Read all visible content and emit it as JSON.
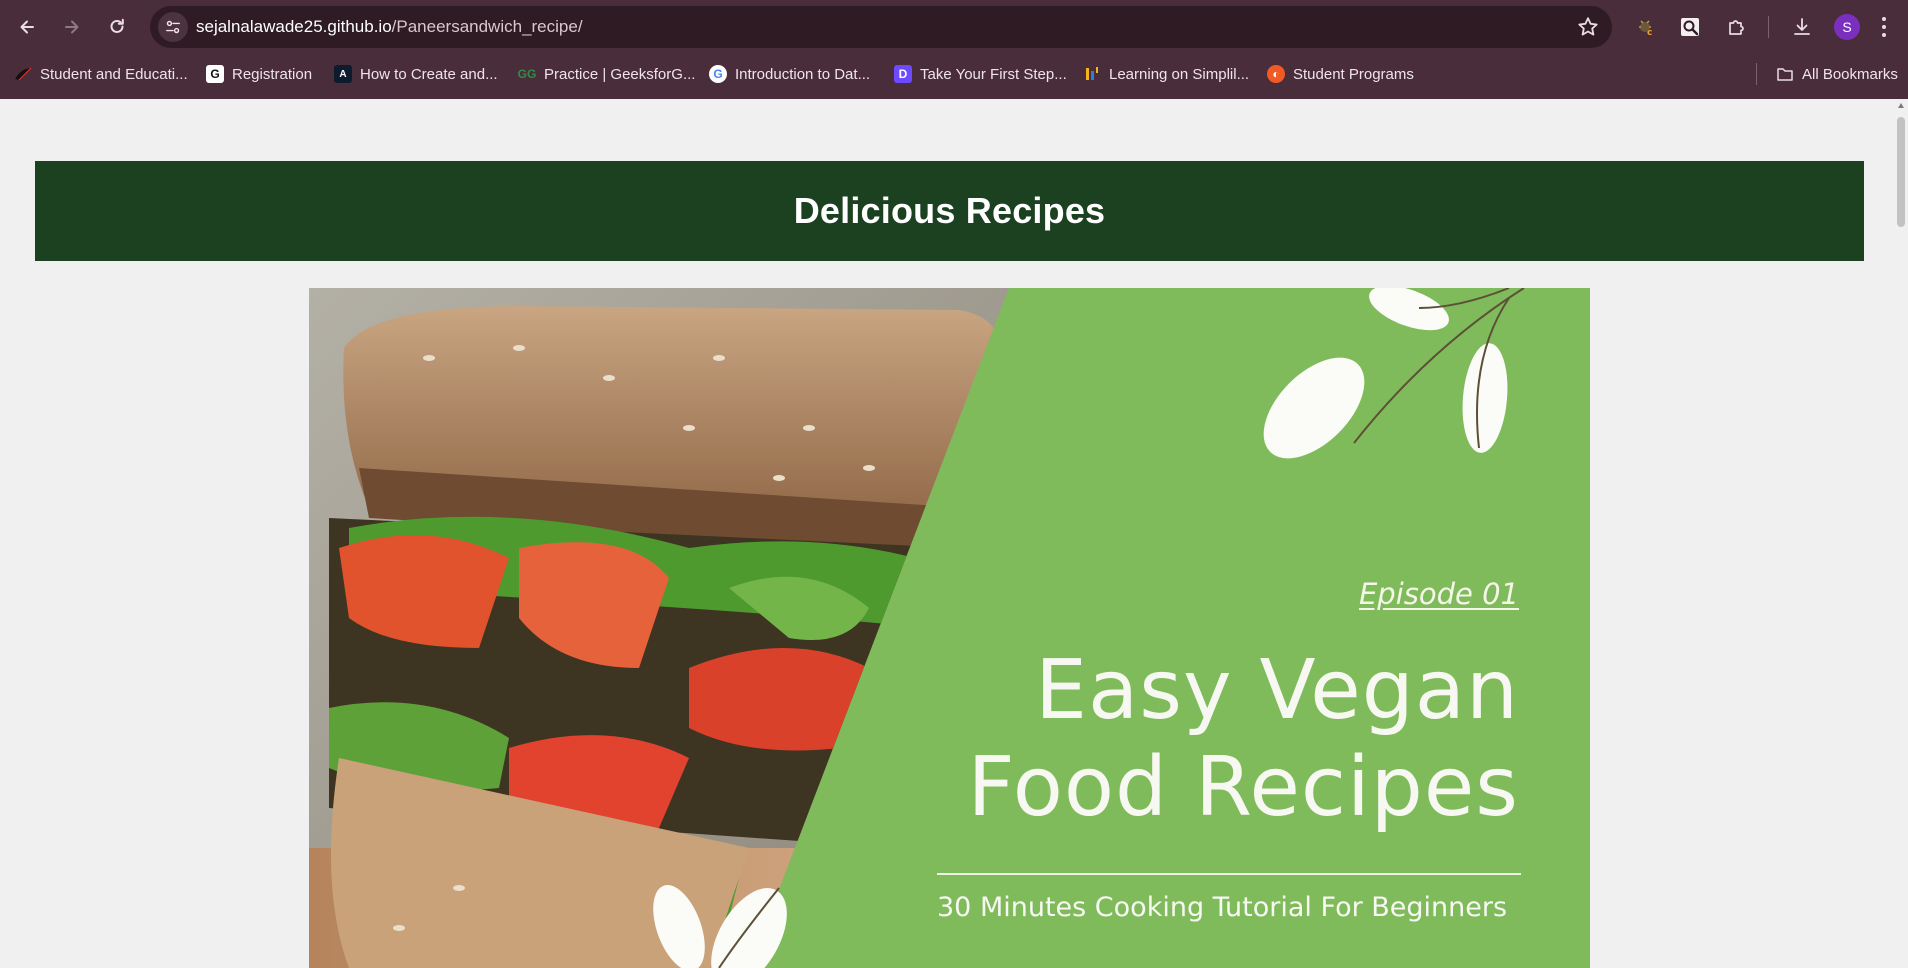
{
  "browser": {
    "url_host": "sejalnalawade25.github.io",
    "url_path": "/Paneersandwich_recipe/",
    "profile_initial": "S",
    "icons": [
      "back-icon",
      "forward-icon",
      "reload-icon",
      "site-info-icon",
      "star-icon",
      "extension-icon",
      "search-lens-icon",
      "puzzle-icon",
      "download-icon",
      "kebab-menu-icon"
    ],
    "bookmarks": [
      {
        "label": "Student and Educati...",
        "icon": "student-favicon"
      },
      {
        "label": "Registration",
        "icon": "g-favicon"
      },
      {
        "label": "How to Create and...",
        "icon": "angular-favicon"
      },
      {
        "label": "Practice | GeeksforG...",
        "icon": "gfg-favicon"
      },
      {
        "label": "Introduction to Dat...",
        "icon": "google-favicon"
      },
      {
        "label": "Take Your First Step...",
        "icon": "d-favicon"
      },
      {
        "label": "Learning on Simplil...",
        "icon": "simplilearn-favicon"
      },
      {
        "label": "Student Programs",
        "icon": "student-programs-favicon"
      }
    ],
    "all_bookmarks": "All Bookmarks"
  },
  "page": {
    "header_title": "Delicious Recipes",
    "hero": {
      "episode": "Episode 01",
      "title_line1": "Easy Vegan",
      "title_line2": "Food Recipes",
      "subtitle": "30 Minutes Cooking Tutorial For Beginners"
    }
  },
  "colors": {
    "chrome_bg": "#4a2d3b",
    "omnibox_bg": "#2e1b24",
    "header_bg": "#1b4121",
    "hero_green": "#7fbb5b",
    "page_bg": "#f1f0f0"
  }
}
